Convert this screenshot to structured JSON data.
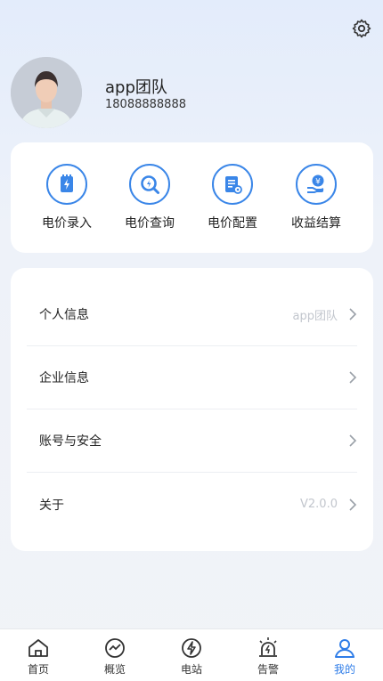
{
  "profile": {
    "name": "app团队",
    "phone": "18088888888"
  },
  "quick_actions": [
    {
      "label": "电价录入",
      "icon": "price-entry-icon"
    },
    {
      "label": "电价查询",
      "icon": "price-query-icon"
    },
    {
      "label": "电价配置",
      "icon": "price-config-icon"
    },
    {
      "label": "收益结算",
      "icon": "revenue-settlement-icon"
    }
  ],
  "menu": [
    {
      "label": "个人信息",
      "value": "app团队"
    },
    {
      "label": "企业信息",
      "value": ""
    },
    {
      "label": "账号与安全",
      "value": ""
    },
    {
      "label": "关于",
      "value": "V2.0.0"
    }
  ],
  "tabbar": [
    {
      "label": "首页",
      "icon": "home-icon"
    },
    {
      "label": "概览",
      "icon": "overview-icon"
    },
    {
      "label": "电站",
      "icon": "power-station-icon"
    },
    {
      "label": "告警",
      "icon": "alarm-icon"
    },
    {
      "label": "我的",
      "icon": "user-icon",
      "active": true
    }
  ],
  "colors": {
    "accent": "#2f7de8",
    "icon_blue": "#3a86e8"
  }
}
